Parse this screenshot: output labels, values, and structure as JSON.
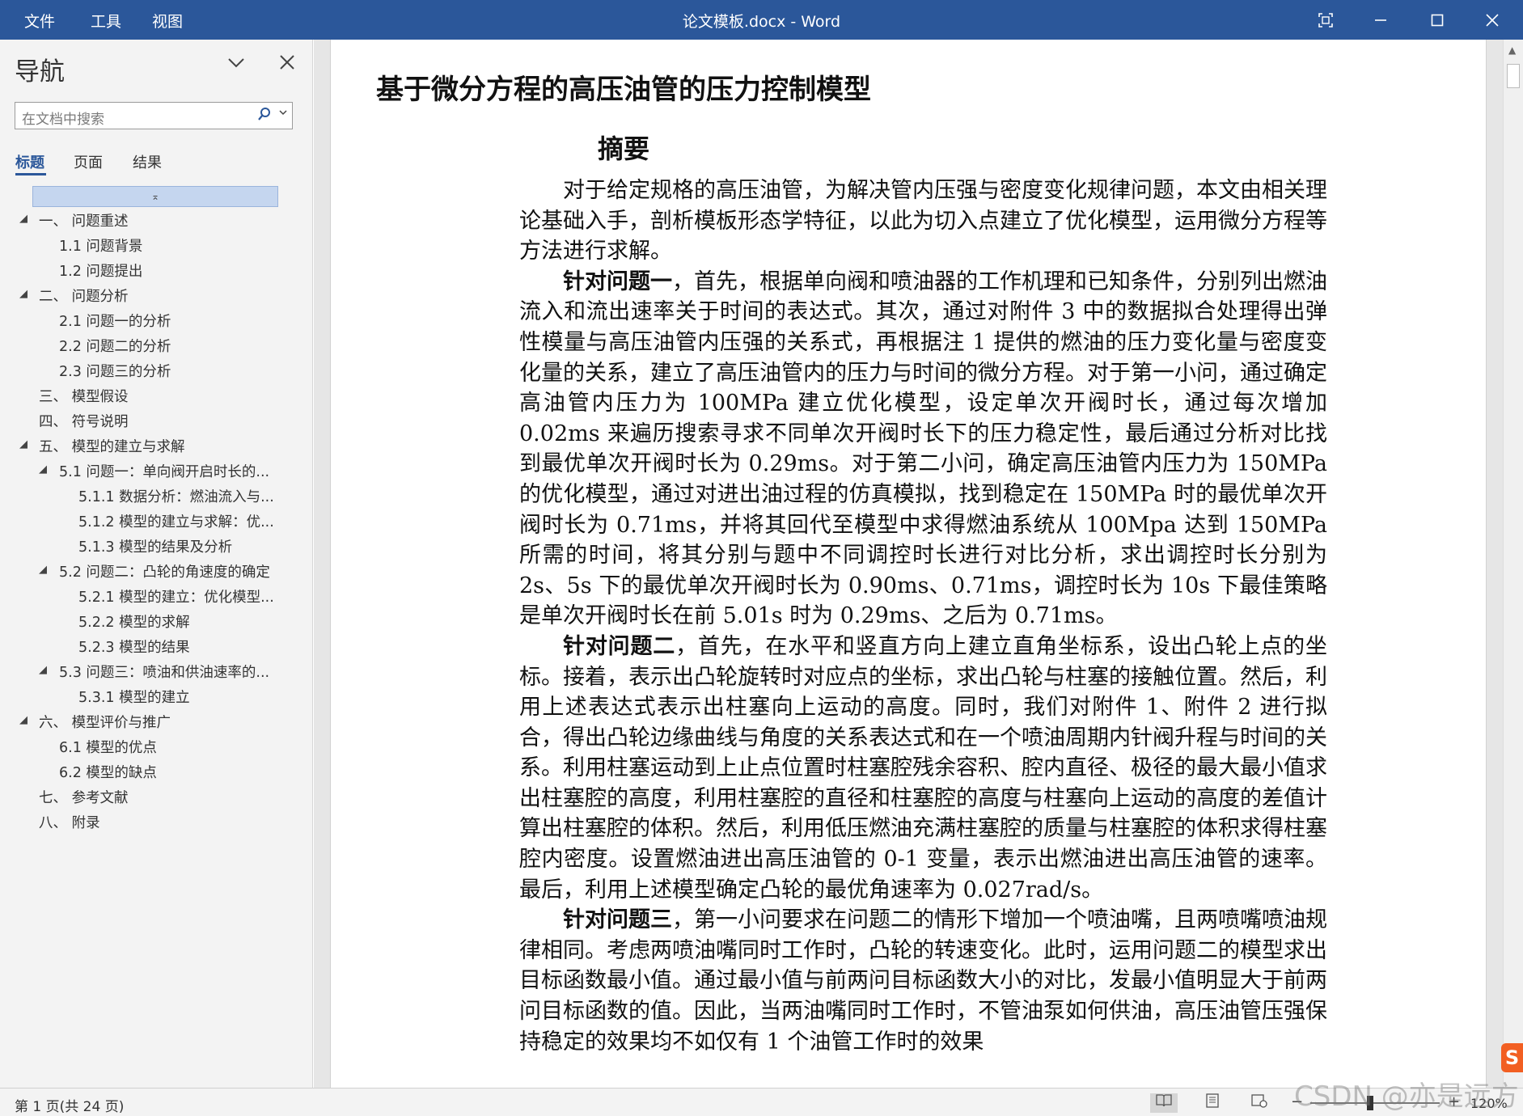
{
  "menu": {
    "file": "文件",
    "tools": "工具",
    "view": "视图"
  },
  "window": {
    "title": "论文模板.docx  -  Word"
  },
  "nav": {
    "title": "导航",
    "search_placeholder": "在文档中搜索",
    "tabs": [
      "标题",
      "页面",
      "结果"
    ],
    "headings": [
      "一、 问题重述",
      "1.1 问题背景",
      "1.2 问题提出",
      "二、 问题分析",
      "2.1 问题一的分析",
      "2.2 问题二的分析",
      "2.3 问题三的分析",
      "三、 模型假设",
      "四、 符号说明",
      "五、 模型的建立与求解",
      "5.1 问题一：单向阀开启时长的...",
      "5.1.1 数据分析：燃油流入与...",
      "5.1.2 模型的建立与求解：优...",
      "5.1.3 模型的结果及分析",
      "5.2 问题二：凸轮的角速度的确定",
      "5.2.1 模型的建立：优化模型...",
      "5.2.2 模型的求解",
      "5.2.3 模型的结果",
      "5.3 问题三：喷油和供油速率的...",
      "5.3.1 模型的建立",
      "六、 模型评价与推广",
      "6.1 模型的优点",
      "6.2 模型的缺点",
      "七、 参考文献",
      "八、 附录"
    ]
  },
  "document": {
    "title": "基于微分方程的高压油管的压力控制模型",
    "abstract_heading": "摘要",
    "p1": "对于给定规格的高压油管，为解决管内压强与密度变化规律问题，本文由相关理论基础入手，剖析模板形态学特征，以此为切入点建立了优化模型，运用微分方程等方法进行求解。",
    "p2_lead": "针对问题一",
    "p2": "，首先，根据单向阀和喷油器的工作机理和已知条件，分别列出燃油流入和流出速率关于时间的表达式。其次，通过对附件 3 中的数据拟合处理得出弹性模量与高压油管内压强的关系式，再根据注 1 提供的燃油的压力变化量与密度变化量的关系，建立了高压油管内的压力与时间的微分方程。对于第一小问，通过确定高油管内压力为 100MPa 建立优化模型，设定单次开阀时长，通过每次增加 0.02ms 来遍历搜索寻求不同单次开阀时长下的压力稳定性，最后通过分析对比找到最优单次开阀时长为 0.29ms。对于第二小问，确定高压油管内压力为 150MPa 的优化模型，通过对进出油过程的仿真模拟，找到稳定在 150MPa 时的最优单次开阀时长为 0.71ms，并将其回代至模型中求得燃油系统从 100Mpa 达到 150MPa 所需的时间，将其分别与题中不同调控时长进行对比分析，求出调控时长分别为 2s、5s 下的最优单次开阀时长为 0.90ms、0.71ms，调控时长为 10s 下最佳策略是单次开阀时长在前 5.01s 时为 0.29ms、之后为 0.71ms。",
    "p3_lead": "针对问题二",
    "p3": "，首先，在水平和竖直方向上建立直角坐标系，设出凸轮上点的坐标。接着，表示出凸轮旋转时对应点的坐标，求出凸轮与柱塞的接触位置。然后，利用上述表达式表示出柱塞向上运动的高度。同时，我们对附件 1、附件 2 进行拟合，得出凸轮边缘曲线与角度的关系表达式和在一个喷油周期内针阀升程与时间的关系。利用柱塞运动到上止点位置时柱塞腔残余容积、腔内直径、极径的最大最小值求出柱塞腔的高度，利用柱塞腔的直径和柱塞腔的高度与柱塞向上运动的高度的差值计算出柱塞腔的体积。然后，利用低压燃油充满柱塞腔的质量与柱塞腔的体积求得柱塞腔内密度。设置燃油进出高压油管的 0-1 变量，表示出燃油进出高压油管的速率。最后，利用上述模型确定凸轮的最优角速率为 0.027rad/s。",
    "p4_lead": "针对问题三",
    "p4": "，第一小问要求在问题二的情形下增加一个喷油嘴，且两喷嘴喷油规律相同。考虑两喷油嘴同时工作时，凸轮的转速变化。此时，运用问题二的模型求出目标函数最小值。通过最小值与前两问目标函数大小的对比，发最小值明显大于前两问目标函数的值。因此，当两油嘴同时工作时，不管油泵如何供油，高压油管压强保持稳定的效果均不如仅有 1 个油管工作时的效果"
  },
  "status": {
    "page_info": "第 1 页(共 24 页)",
    "zoom": "120%",
    "zoom_percent": 120
  },
  "watermark": "CSDN @亦是远方",
  "icons": {
    "collapse_marker": "⌅",
    "ime": "S"
  },
  "colors": {
    "accent": "#2b579a"
  }
}
